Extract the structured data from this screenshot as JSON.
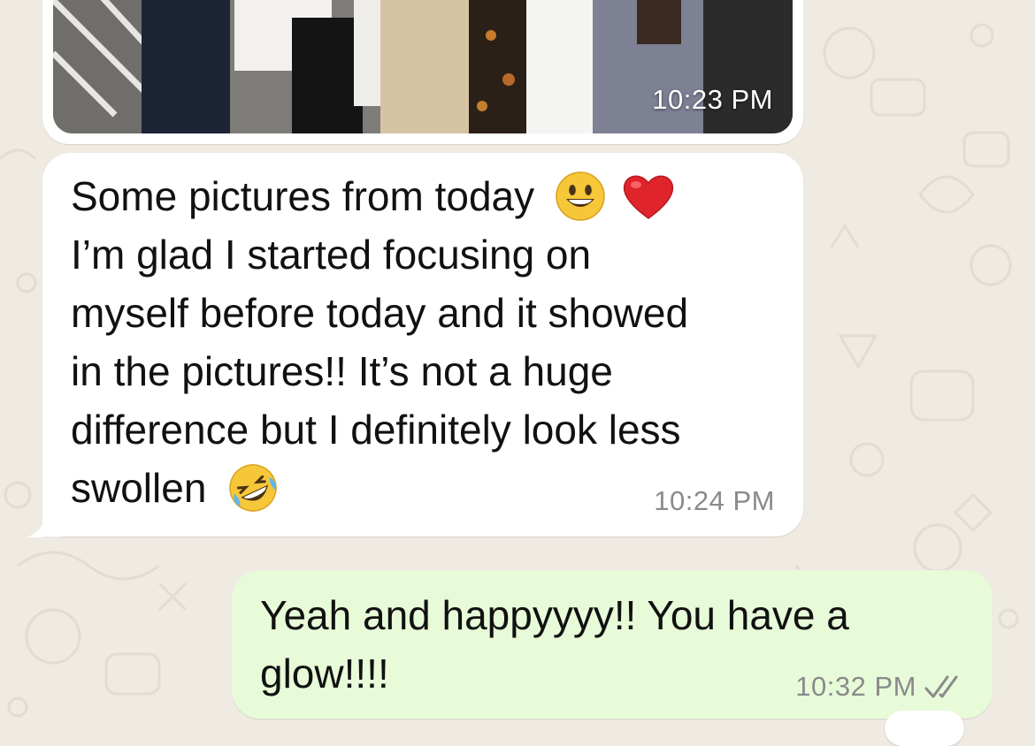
{
  "chat": {
    "image_message": {
      "time": "10:23 PM",
      "kind": "photo"
    },
    "incoming_message": {
      "lines": [
        "Some pictures from today",
        "I’m glad I started focusing on",
        "myself before today and it showed",
        "in the pictures!! It’s not a huge",
        "difference but I definitely look less",
        "swollen"
      ],
      "emojis": [
        "grinning-face",
        "red-heart",
        "rolling-on-floor-laughing"
      ],
      "time": "10:24 PM"
    },
    "outgoing_message": {
      "lines": [
        "Yeah and happyyyy!! You have a",
        "glow!!!!"
      ],
      "time": "10:32 PM",
      "status": "read-double-check"
    }
  },
  "colors": {
    "wallpaper": "#efeae2",
    "incoming_bubble": "#ffffff",
    "outgoing_bubble": "#e7fbd9",
    "timestamp": "#8a8a8a",
    "read_ticks": "#8a8a8a"
  }
}
